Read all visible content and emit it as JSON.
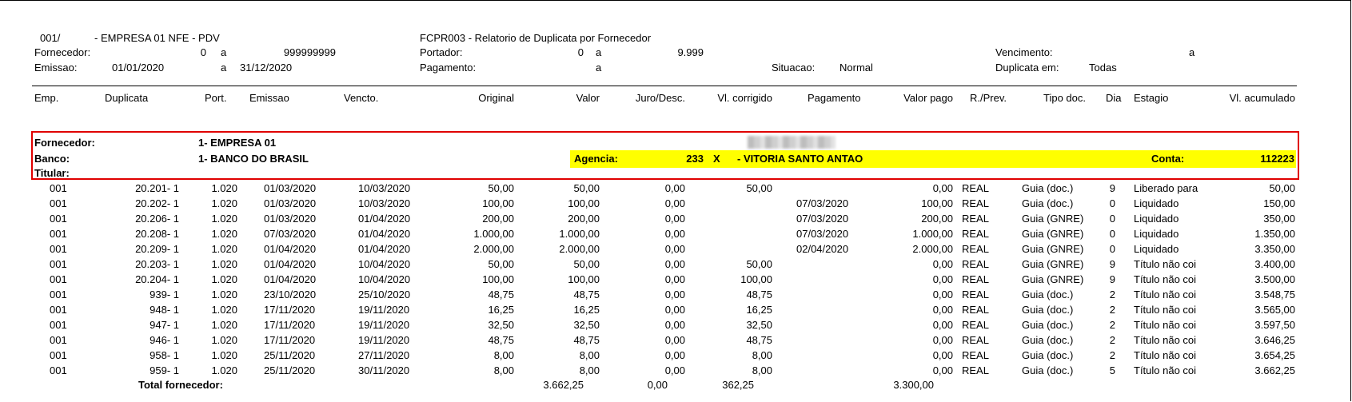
{
  "header": {
    "company_code": "001/",
    "company_name": "- EMPRESA 01 NFE - PDV",
    "report_title": "FCPR003 - Relatorio de Duplicata por Fornecedor",
    "fornecedor_label": "Fornecedor:",
    "fornecedor_from": "0",
    "fornecedor_a": "a",
    "fornecedor_to": "999999999",
    "emissao_label": "Emissao:",
    "emissao_from": "01/01/2020",
    "emissao_a": "a",
    "emissao_to": "31/12/2020",
    "portador_label": "Portador:",
    "portador_from": "0",
    "portador_a": "a",
    "portador_to": "9.999",
    "pagamento_label": "Pagamento:",
    "pagamento_a": "a",
    "situacao_label": "Situacao:",
    "situacao_value": "Normal",
    "vencimento_label": "Vencimento:",
    "vencimento_a": "a",
    "duplicata_em_label": "Duplicata em:",
    "duplicata_em_value": "Todas"
  },
  "columns": {
    "emp": "Emp.",
    "duplicata": "Duplicata",
    "port": "Port.",
    "emissao": "Emissao",
    "vencto": "Vencto.",
    "original": "Original",
    "valor": "Valor",
    "juro": "Juro/Desc.",
    "vl_corrigido": "Vl. corrigido",
    "pagamento": "Pagamento",
    "valor_pago": "Valor pago",
    "r_prev": "R./Prev.",
    "tipo_doc": "Tipo doc.",
    "dia": "Dia",
    "estagio": "Estagio",
    "vl_acumulado": "Vl. acumulado"
  },
  "supplier": {
    "fornecedor_label": "Fornecedor:",
    "fornecedor_value": "1- EMPRESA 01",
    "banco_label": "Banco:",
    "banco_value": "1- BANCO DO BRASIL",
    "titular_label": "Titular:",
    "agencia_label": "Agencia:",
    "agencia_value": "233",
    "agencia_x": "X",
    "agencia_name": "- VITORIA SANTO ANTAO",
    "conta_label": "Conta:",
    "conta_value": "112223"
  },
  "rows": [
    {
      "emp": "001",
      "dup": "20.201- 1",
      "port": "1.020",
      "emi": "01/03/2020",
      "ven": "10/03/2020",
      "orig": "50,00",
      "valor": "50,00",
      "juro": "0,00",
      "vlc": "50,00",
      "pag": "",
      "vpago": "0,00",
      "rprev": "REAL",
      "tipo": "Guia (doc.)",
      "dia": "9",
      "est": "Liberado para",
      "acum": "50,00"
    },
    {
      "emp": "001",
      "dup": "20.202- 1",
      "port": "1.020",
      "emi": "01/03/2020",
      "ven": "10/03/2020",
      "orig": "100,00",
      "valor": "100,00",
      "juro": "0,00",
      "vlc": "",
      "pag": "07/03/2020",
      "vpago": "100,00",
      "rprev": "REAL",
      "tipo": "Guia (doc.)",
      "dia": "0",
      "est": "Liquidado",
      "acum": "150,00"
    },
    {
      "emp": "001",
      "dup": "20.206- 1",
      "port": "1.020",
      "emi": "01/03/2020",
      "ven": "01/04/2020",
      "orig": "200,00",
      "valor": "200,00",
      "juro": "0,00",
      "vlc": "",
      "pag": "07/03/2020",
      "vpago": "200,00",
      "rprev": "REAL",
      "tipo": "Guia (GNRE)",
      "dia": "0",
      "est": "Liquidado",
      "acum": "350,00"
    },
    {
      "emp": "001",
      "dup": "20.208- 1",
      "port": "1.020",
      "emi": "07/03/2020",
      "ven": "01/04/2020",
      "orig": "1.000,00",
      "valor": "1.000,00",
      "juro": "0,00",
      "vlc": "",
      "pag": "07/03/2020",
      "vpago": "1.000,00",
      "rprev": "REAL",
      "tipo": "Guia (GNRE)",
      "dia": "0",
      "est": "Liquidado",
      "acum": "1.350,00"
    },
    {
      "emp": "001",
      "dup": "20.209- 1",
      "port": "1.020",
      "emi": "01/04/2020",
      "ven": "01/04/2020",
      "orig": "2.000,00",
      "valor": "2.000,00",
      "juro": "0,00",
      "vlc": "",
      "pag": "02/04/2020",
      "vpago": "2.000,00",
      "rprev": "REAL",
      "tipo": "Guia (GNRE)",
      "dia": "0",
      "est": "Liquidado",
      "acum": "3.350,00"
    },
    {
      "emp": "001",
      "dup": "20.203- 1",
      "port": "1.020",
      "emi": "01/04/2020",
      "ven": "10/04/2020",
      "orig": "50,00",
      "valor": "50,00",
      "juro": "0,00",
      "vlc": "50,00",
      "pag": "",
      "vpago": "0,00",
      "rprev": "REAL",
      "tipo": "Guia (GNRE)",
      "dia": "9",
      "est": "Título não coi",
      "acum": "3.400,00"
    },
    {
      "emp": "001",
      "dup": "20.204- 1",
      "port": "1.020",
      "emi": "01/04/2020",
      "ven": "10/04/2020",
      "orig": "100,00",
      "valor": "100,00",
      "juro": "0,00",
      "vlc": "100,00",
      "pag": "",
      "vpago": "0,00",
      "rprev": "REAL",
      "tipo": "Guia (GNRE)",
      "dia": "9",
      "est": "Título não coi",
      "acum": "3.500,00"
    },
    {
      "emp": "001",
      "dup": "939- 1",
      "port": "1.020",
      "emi": "23/10/2020",
      "ven": "25/10/2020",
      "orig": "48,75",
      "valor": "48,75",
      "juro": "0,00",
      "vlc": "48,75",
      "pag": "",
      "vpago": "0,00",
      "rprev": "REAL",
      "tipo": "Guia (doc.)",
      "dia": "2",
      "est": "Título não coi",
      "acum": "3.548,75"
    },
    {
      "emp": "001",
      "dup": "948- 1",
      "port": "1.020",
      "emi": "17/11/2020",
      "ven": "19/11/2020",
      "orig": "16,25",
      "valor": "16,25",
      "juro": "0,00",
      "vlc": "16,25",
      "pag": "",
      "vpago": "0,00",
      "rprev": "REAL",
      "tipo": "Guia (doc.)",
      "dia": "2",
      "est": "Título não coi",
      "acum": "3.565,00"
    },
    {
      "emp": "001",
      "dup": "947- 1",
      "port": "1.020",
      "emi": "17/11/2020",
      "ven": "19/11/2020",
      "orig": "32,50",
      "valor": "32,50",
      "juro": "0,00",
      "vlc": "32,50",
      "pag": "",
      "vpago": "0,00",
      "rprev": "REAL",
      "tipo": "Guia (doc.)",
      "dia": "2",
      "est": "Título não coi",
      "acum": "3.597,50"
    },
    {
      "emp": "001",
      "dup": "946- 1",
      "port": "1.020",
      "emi": "17/11/2020",
      "ven": "19/11/2020",
      "orig": "48,75",
      "valor": "48,75",
      "juro": "0,00",
      "vlc": "48,75",
      "pag": "",
      "vpago": "0,00",
      "rprev": "REAL",
      "tipo": "Guia (doc.)",
      "dia": "2",
      "est": "Título não coi",
      "acum": "3.646,25"
    },
    {
      "emp": "001",
      "dup": "958- 1",
      "port": "1.020",
      "emi": "25/11/2020",
      "ven": "27/11/2020",
      "orig": "8,00",
      "valor": "8,00",
      "juro": "0,00",
      "vlc": "8,00",
      "pag": "",
      "vpago": "0,00",
      "rprev": "REAL",
      "tipo": "Guia (doc.)",
      "dia": "2",
      "est": "Título não coi",
      "acum": "3.654,25"
    },
    {
      "emp": "001",
      "dup": "959- 1",
      "port": "1.020",
      "emi": "25/11/2020",
      "ven": "30/11/2020",
      "orig": "8,00",
      "valor": "8,00",
      "juro": "0,00",
      "vlc": "8,00",
      "pag": "",
      "vpago": "0,00",
      "rprev": "REAL",
      "tipo": "Guia (doc.)",
      "dia": "5",
      "est": "Título não coi",
      "acum": "3.662,25"
    }
  ],
  "totals": {
    "label": "Total fornecedor:",
    "valor": "3.662,25",
    "juro": "0,00",
    "vl_corrigido": "362,25",
    "valor_pago": "3.300,00"
  }
}
